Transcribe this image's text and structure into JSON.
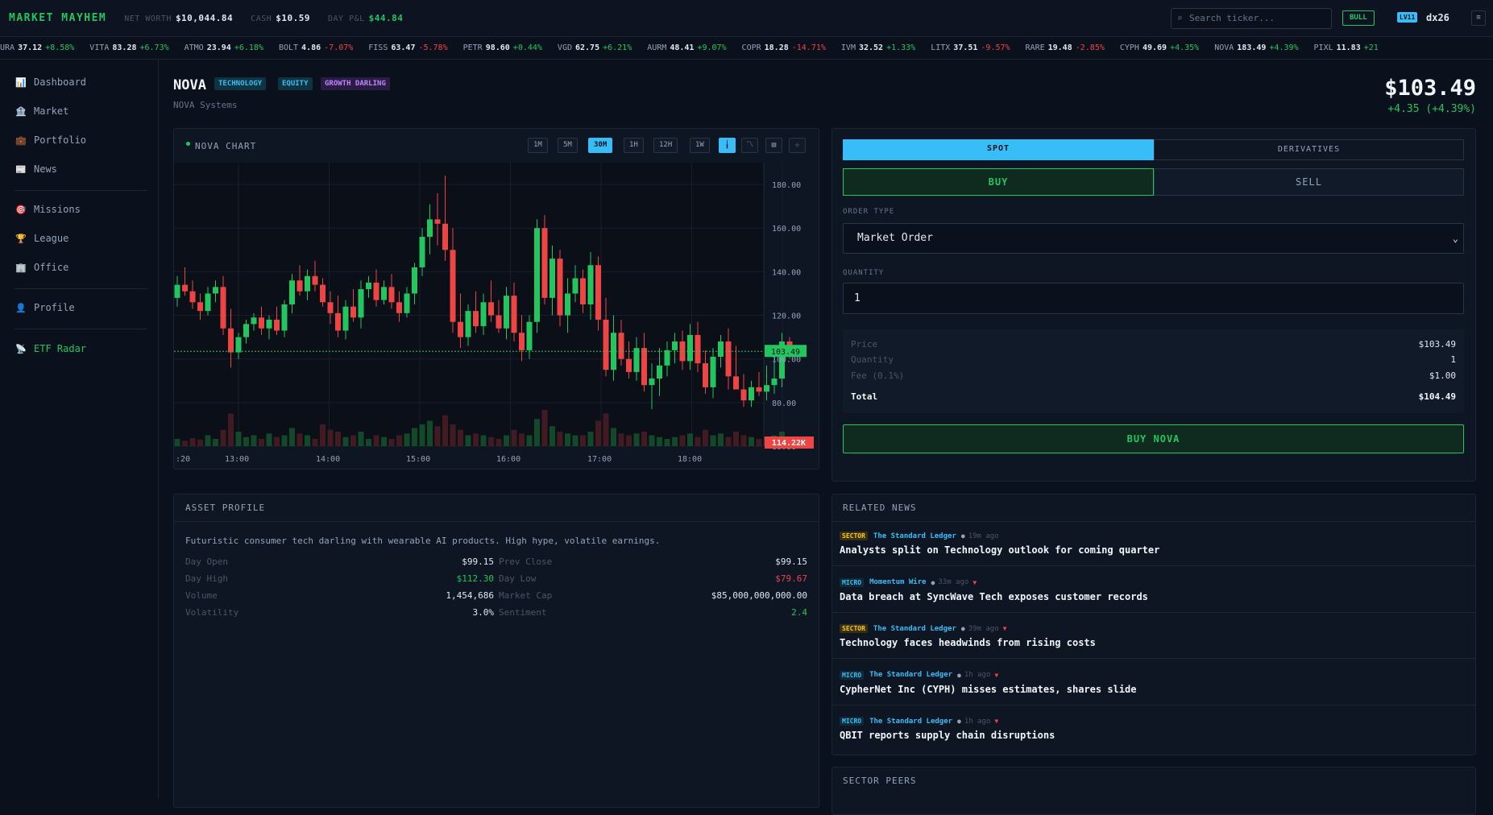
{
  "header": {
    "brand": "MARKET MAYHEM",
    "net_worth_label": "NET WORTH",
    "net_worth": "$10,044.84",
    "cash_label": "CASH",
    "cash": "$10.59",
    "pnl_label": "DAY P&L",
    "pnl": "$44.84",
    "search_placeholder": "Search ticker...",
    "regime": "BULL",
    "level": "LV11",
    "username": "dx26",
    "menu_icon": "menu-icon"
  },
  "ticker": [
    {
      "sym": "URA",
      "price": "37.12",
      "chg": "+8.58%",
      "dir": "up"
    },
    {
      "sym": "VITA",
      "price": "83.28",
      "chg": "+6.73%",
      "dir": "up"
    },
    {
      "sym": "ATMO",
      "price": "23.94",
      "chg": "+6.18%",
      "dir": "up"
    },
    {
      "sym": "BOLT",
      "price": "4.86",
      "chg": "-7.07%",
      "dir": "dn"
    },
    {
      "sym": "FISS",
      "price": "63.47",
      "chg": "-5.78%",
      "dir": "dn"
    },
    {
      "sym": "PETR",
      "price": "98.60",
      "chg": "+0.44%",
      "dir": "up"
    },
    {
      "sym": "VGD",
      "price": "62.75",
      "chg": "+6.21%",
      "dir": "up"
    },
    {
      "sym": "AURM",
      "price": "48.41",
      "chg": "+9.07%",
      "dir": "up"
    },
    {
      "sym": "COPR",
      "price": "18.28",
      "chg": "-14.71%",
      "dir": "dn"
    },
    {
      "sym": "IVM",
      "price": "32.52",
      "chg": "+1.33%",
      "dir": "up"
    },
    {
      "sym": "LITX",
      "price": "37.51",
      "chg": "-9.57%",
      "dir": "dn"
    },
    {
      "sym": "RARE",
      "price": "19.48",
      "chg": "-2.85%",
      "dir": "dn"
    },
    {
      "sym": "CYPH",
      "price": "49.69",
      "chg": "+4.35%",
      "dir": "up"
    },
    {
      "sym": "NOVA",
      "price": "183.49",
      "chg": "+4.39%",
      "dir": "up"
    },
    {
      "sym": "PIXL",
      "price": "11.83",
      "chg": "+21",
      "dir": "up"
    }
  ],
  "sidebar": {
    "items": [
      {
        "label": "Dashboard",
        "icon": "chart-icon"
      },
      {
        "label": "Market",
        "icon": "bank-icon"
      },
      {
        "label": "Portfolio",
        "icon": "briefcase-icon"
      },
      {
        "label": "News",
        "icon": "newspaper-icon"
      },
      {
        "label": "Missions",
        "icon": "target-icon"
      },
      {
        "label": "League",
        "icon": "trophy-icon"
      },
      {
        "label": "Office",
        "icon": "office-icon"
      },
      {
        "label": "Profile",
        "icon": "person-icon"
      },
      {
        "label": "ETF Radar",
        "icon": "satellite-icon"
      }
    ]
  },
  "asset": {
    "ticker": "NOVA",
    "tags": [
      "TECHNOLOGY",
      "EQUITY",
      "GROWTH DARLING"
    ],
    "name": "NOVA Systems",
    "price": "$103.49",
    "change": "+4.35 (+4.39%)"
  },
  "chart_panel": {
    "title": "NOVA CHART",
    "timeframes": [
      "1M",
      "5M",
      "30M",
      "1H",
      "12H",
      "1W"
    ],
    "active_timeframe": "30M",
    "tools": [
      "candles-icon",
      "line-icon",
      "bars-icon",
      "star-icon"
    ],
    "current_price_label": "103.49",
    "volume_label": "114.22K"
  },
  "chart_data": {
    "type": "candlestick",
    "y_ticks": [
      "180.00",
      "160.00",
      "140.00",
      "120.00",
      "100.00",
      "80.00",
      "60.00"
    ],
    "ylim": [
      60,
      190
    ],
    "x_ticks": [
      ":20",
      "13:00",
      "14:00",
      "15:00",
      "16:00",
      "17:00",
      "18:00"
    ],
    "current_price": 103.49,
    "candles": [
      [
        128,
        138,
        124,
        134
      ],
      [
        134,
        142,
        129,
        131
      ],
      [
        131,
        136,
        123,
        126
      ],
      [
        126,
        130,
        118,
        122
      ],
      [
        122,
        133,
        120,
        130
      ],
      [
        130,
        136,
        126,
        133
      ],
      [
        133,
        138,
        111,
        114
      ],
      [
        114,
        123,
        96,
        103
      ],
      [
        103,
        112,
        100,
        110
      ],
      [
        110,
        118,
        107,
        116
      ],
      [
        116,
        121,
        113,
        119
      ],
      [
        119,
        124,
        111,
        114
      ],
      [
        114,
        120,
        109,
        118
      ],
      [
        118,
        124,
        111,
        113
      ],
      [
        113,
        127,
        110,
        125
      ],
      [
        125,
        139,
        121,
        136
      ],
      [
        136,
        143,
        129,
        131
      ],
      [
        131,
        141,
        127,
        138
      ],
      [
        138,
        145,
        131,
        134
      ],
      [
        134,
        137,
        124,
        126
      ],
      [
        126,
        131,
        116,
        121
      ],
      [
        121,
        129,
        110,
        113
      ],
      [
        113,
        127,
        109,
        124
      ],
      [
        124,
        132,
        117,
        119
      ],
      [
        119,
        136,
        114,
        132
      ],
      [
        132,
        138,
        128,
        135
      ],
      [
        135,
        141,
        124,
        127
      ],
      [
        127,
        136,
        125,
        133
      ],
      [
        133,
        139,
        123,
        126
      ],
      [
        126,
        131,
        117,
        121
      ],
      [
        121,
        133,
        119,
        130
      ],
      [
        130,
        144,
        125,
        142
      ],
      [
        142,
        160,
        138,
        156
      ],
      [
        156,
        171,
        148,
        164
      ],
      [
        164,
        176,
        152,
        162
      ],
      [
        162,
        184,
        145,
        150
      ],
      [
        150,
        160,
        112,
        117
      ],
      [
        117,
        130,
        105,
        110
      ],
      [
        110,
        125,
        106,
        122
      ],
      [
        122,
        131,
        112,
        115
      ],
      [
        115,
        130,
        111,
        126
      ],
      [
        126,
        136,
        117,
        120
      ],
      [
        120,
        127,
        112,
        114
      ],
      [
        114,
        133,
        109,
        129
      ],
      [
        129,
        135,
        108,
        112
      ],
      [
        112,
        120,
        99,
        104
      ],
      [
        104,
        120,
        100,
        117
      ],
      [
        117,
        164,
        112,
        160
      ],
      [
        160,
        166,
        125,
        128
      ],
      [
        128,
        152,
        120,
        146
      ],
      [
        146,
        150,
        115,
        120
      ],
      [
        120,
        137,
        112,
        130
      ],
      [
        130,
        143,
        126,
        137
      ],
      [
        137,
        141,
        121,
        125
      ],
      [
        125,
        149,
        118,
        143
      ],
      [
        143,
        147,
        113,
        118
      ],
      [
        118,
        128,
        92,
        95
      ],
      [
        95,
        120,
        90,
        112
      ],
      [
        112,
        118,
        97,
        100
      ],
      [
        100,
        108,
        91,
        94
      ],
      [
        94,
        110,
        90,
        105
      ],
      [
        105,
        112,
        85,
        88
      ],
      [
        88,
        98,
        77,
        91
      ],
      [
        91,
        105,
        83,
        97
      ],
      [
        97,
        108,
        92,
        104
      ],
      [
        104,
        112,
        98,
        108
      ],
      [
        108,
        113,
        95,
        99
      ],
      [
        99,
        116,
        95,
        111
      ],
      [
        111,
        117,
        94,
        98
      ],
      [
        98,
        104,
        84,
        87
      ],
      [
        87,
        105,
        82,
        101
      ],
      [
        101,
        111,
        96,
        108
      ],
      [
        108,
        114,
        86,
        92
      ],
      [
        92,
        106,
        88,
        86
      ],
      [
        86,
        93,
        78,
        81
      ],
      [
        81,
        90,
        78,
        87
      ],
      [
        87,
        94,
        83,
        85
      ],
      [
        85,
        97,
        81,
        88
      ],
      [
        88,
        102,
        84,
        91
      ],
      [
        91,
        112,
        87,
        108
      ],
      [
        108,
        110,
        100,
        103
      ]
    ],
    "volume": [
      0.2,
      0.15,
      0.22,
      0.18,
      0.3,
      0.2,
      0.45,
      0.9,
      0.4,
      0.25,
      0.3,
      0.2,
      0.35,
      0.25,
      0.3,
      0.5,
      0.35,
      0.3,
      0.2,
      0.6,
      0.45,
      0.4,
      0.25,
      0.3,
      0.4,
      0.2,
      0.3,
      0.25,
      0.2,
      0.3,
      0.35,
      0.5,
      0.6,
      0.7,
      0.55,
      0.85,
      0.6,
      0.45,
      0.3,
      0.35,
      0.3,
      0.25,
      0.2,
      0.3,
      0.45,
      0.35,
      0.3,
      0.75,
      1.0,
      0.55,
      0.4,
      0.35,
      0.3,
      0.3,
      0.4,
      0.7,
      0.9,
      0.5,
      0.35,
      0.3,
      0.35,
      0.4,
      0.3,
      0.25,
      0.2,
      0.25,
      0.3,
      0.35,
      0.25,
      0.45,
      0.3,
      0.35,
      0.25,
      0.4,
      0.3,
      0.25,
      0.2,
      0.25,
      0.3,
      0.4,
      0.2
    ]
  },
  "order": {
    "tabs": [
      "SPOT",
      "DERIVATIVES"
    ],
    "active_tab": "SPOT",
    "sides": [
      "BUY",
      "SELL"
    ],
    "active_side": "BUY",
    "order_type_label": "ORDER TYPE",
    "order_type": "Market Order",
    "quantity_label": "QUANTITY",
    "quantity": "1",
    "summary": [
      {
        "k": "Price",
        "v": "$103.49"
      },
      {
        "k": "Quantity",
        "v": "1"
      },
      {
        "k": "Fee (0.1%)",
        "v": "$1.00"
      },
      {
        "k": "Total",
        "v": "$104.49"
      }
    ],
    "submit_label": "BUY NOVA"
  },
  "profile": {
    "title": "ASSET PROFILE",
    "description": "Futuristic consumer tech darling with wearable AI products. High hype, volatile earnings.",
    "left": [
      {
        "k": "Day Open",
        "v": "$99.15"
      },
      {
        "k": "Day High",
        "v": "$112.30"
      },
      {
        "k": "Volume",
        "v": "1,454,686"
      },
      {
        "k": "Volatility",
        "v": "3.0%"
      }
    ],
    "right": [
      {
        "k": "Prev Close",
        "v": "$99.15"
      },
      {
        "k": "Day Low",
        "v": "$79.67"
      },
      {
        "k": "Market Cap",
        "v": "$85,000,000,000.00"
      },
      {
        "k": "Sentiment",
        "v": "2.4"
      }
    ],
    "colors": {
      "high": "#22c55e",
      "low": "#ef4444",
      "sentiment": "#22c55e"
    }
  },
  "news": {
    "title": "RELATED NEWS",
    "items": [
      {
        "tag": "SECTOR",
        "source": "The Standard Ledger",
        "age": "19m ago",
        "arrow": "",
        "headline": "Analysts split on Technology outlook for coming quarter"
      },
      {
        "tag": "MICRO",
        "source": "Momentum Wire",
        "age": "33m ago",
        "arrow": "▼",
        "headline": "Data breach at SyncWave Tech exposes customer records"
      },
      {
        "tag": "SECTOR",
        "source": "The Standard Ledger",
        "age": "39m ago",
        "arrow": "▼",
        "headline": "Technology faces headwinds from rising costs"
      },
      {
        "tag": "MICRO",
        "source": "The Standard Ledger",
        "age": "1h ago",
        "arrow": "▼",
        "headline": "CypherNet Inc (CYPH) misses estimates, shares slide"
      },
      {
        "tag": "MICRO",
        "source": "The Standard Ledger",
        "age": "1h ago",
        "arrow": "▼",
        "headline": "QBIT reports supply chain disruptions"
      }
    ]
  },
  "peers": {
    "title": "SECTOR PEERS"
  }
}
